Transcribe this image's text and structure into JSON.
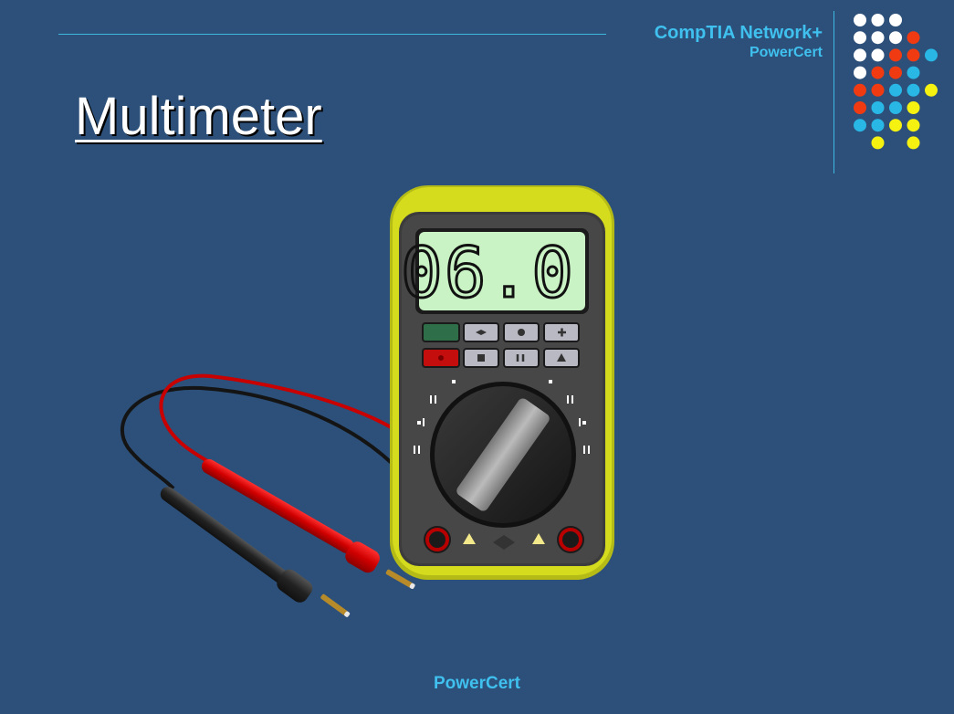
{
  "header": {
    "brand_line1": "CompTIA Network+",
    "brand_line2": "PowerCert"
  },
  "slide": {
    "title": "Multimeter"
  },
  "meter": {
    "display_reading": "06.0"
  },
  "footer": {
    "text": "PowerCert"
  },
  "colors": {
    "background": "#2c5079",
    "accent": "#3fc0ee",
    "dot_white": "#ffffff",
    "dot_red": "#f03b12",
    "dot_blue": "#29b7e6",
    "dot_yellow": "#f5f212"
  },
  "dot_rows": [
    [
      "white",
      "white",
      "white"
    ],
    [
      "white",
      "white",
      "white",
      "red"
    ],
    [
      "white",
      "white",
      "red",
      "red",
      "blue"
    ],
    [
      "white",
      "red",
      "red",
      "blue"
    ],
    [
      "red",
      "red",
      "blue",
      "blue",
      "yellow"
    ],
    [
      "red",
      "blue",
      "blue",
      "yellow"
    ],
    [
      "blue",
      "blue",
      "yellow",
      "yellow"
    ],
    [
      "yellow",
      "yellow"
    ]
  ]
}
